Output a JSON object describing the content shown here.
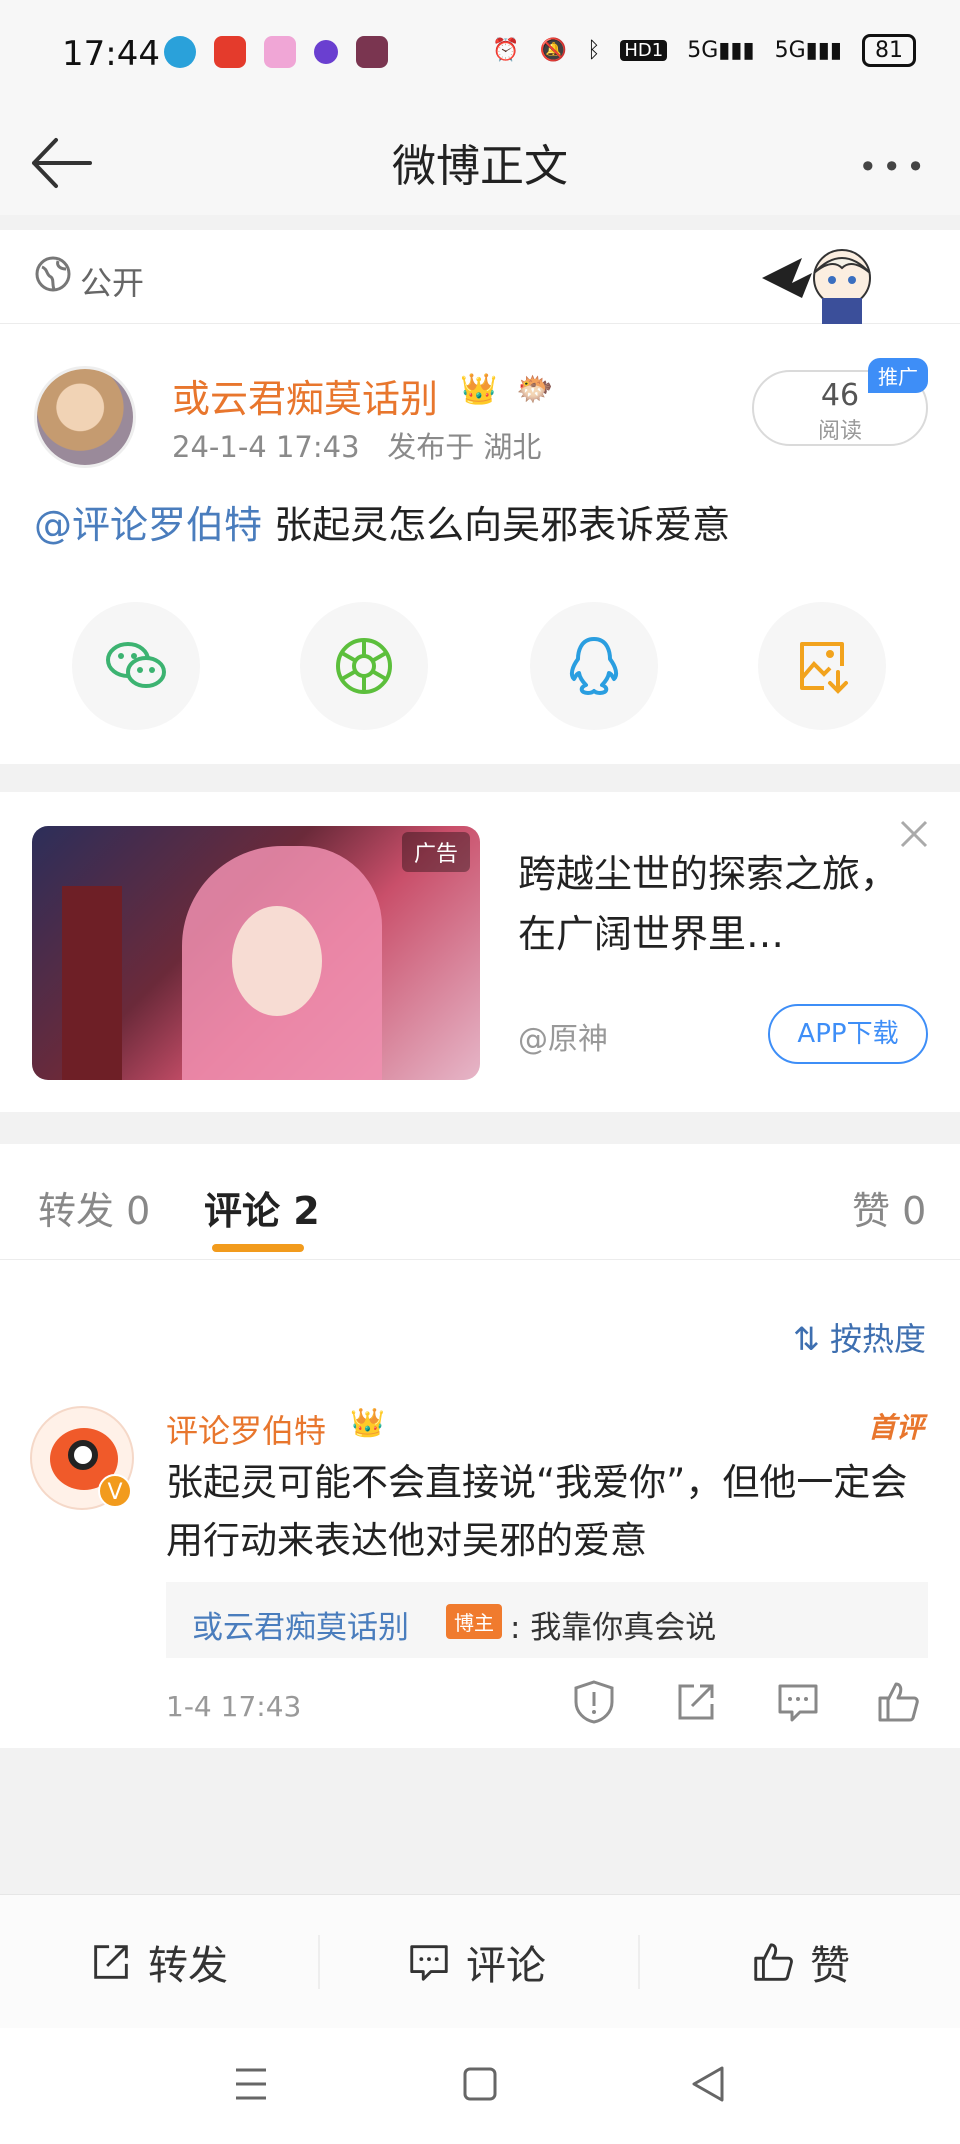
{
  "status_bar": {
    "time": "17:44",
    "icons": [
      "telegram-icon",
      "espn-app-icon",
      "camera-app-icon",
      "app-icon",
      "game-app-icon"
    ],
    "system_icons": [
      "alarm-icon",
      "mute-icon",
      "bluetooth-icon",
      "hd-icon",
      "5g-signal-icon",
      "5g-signal-icon"
    ],
    "hd_label": "HD1",
    "battery": "81"
  },
  "nav": {
    "title": "微博正文",
    "more_label": "•••"
  },
  "visibility": {
    "label": "公开"
  },
  "post": {
    "username": "或云君痴莫话别",
    "time": "24-1-4 17:43",
    "location": "发布于 湖北",
    "read_count": "46",
    "read_label": "阅读",
    "promo_tag": "推广",
    "mention": "@评论罗伯特",
    "text": " 张起灵怎么向吴邪表诉爱意",
    "share_targets": [
      "wechat-icon",
      "moments-icon",
      "qq-icon",
      "save-image-icon"
    ]
  },
  "ad": {
    "tag": "广告",
    "text": "跨越尘世的探索之旅，在广阔世界里…",
    "source": "@原神",
    "button": "APP下载"
  },
  "tabs": {
    "repost": "转发 0",
    "comment": "评论 2",
    "like": "赞 0"
  },
  "comments": {
    "sort_label": "按热度",
    "items": [
      {
        "username": "评论罗伯特",
        "badge": "首评",
        "text": "张起灵可能不会直接说“我爱你”，但他一定会用行动来表达他对吴邪的爱意",
        "reply_user": "或云君痴莫话别",
        "reply_badge": "博主",
        "reply_text": ": 我靠你真会说",
        "time": "1-4 17:43"
      }
    ]
  },
  "bottom_bar": {
    "repost": "转发",
    "comment": "评论",
    "like": "赞"
  },
  "colors": {
    "accent_orange": "#e8762d",
    "link_blue": "#4a7dbd",
    "tab_underline": "#f29b1d",
    "promo_blue": "#3e8ef7"
  }
}
